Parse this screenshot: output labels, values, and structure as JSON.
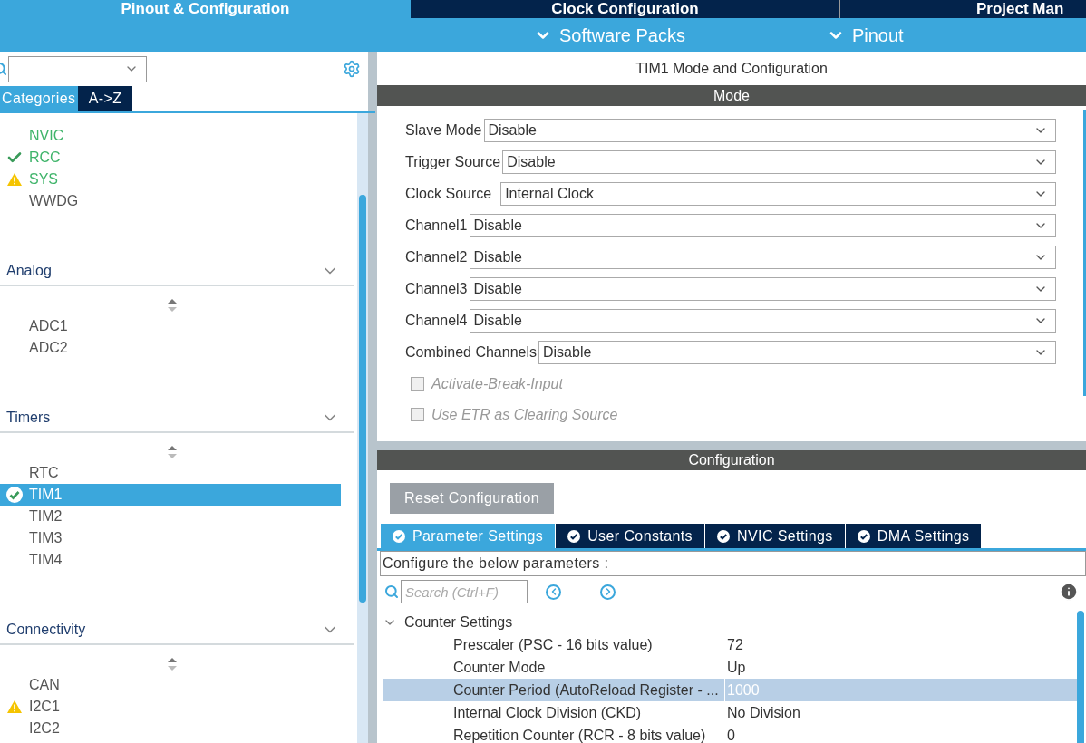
{
  "main_tabs": [
    {
      "label": "Pinout & Configuration",
      "selected": true
    },
    {
      "label": "Clock Configuration",
      "selected": false
    },
    {
      "label": "Project Man",
      "selected": false
    }
  ],
  "sub_menu": [
    "Software Packs",
    "Pinout"
  ],
  "sidebar": {
    "view_tabs": [
      {
        "label": "Categories",
        "selected": true
      },
      {
        "label": "A->Z",
        "selected": false
      }
    ],
    "top_items": [
      {
        "label": "NVIC",
        "kind": "none",
        "enabled": true,
        "selected": false
      },
      {
        "label": "RCC",
        "kind": "check",
        "enabled": true,
        "selected": false
      },
      {
        "label": "SYS",
        "kind": "warning",
        "enabled": true,
        "selected": false
      },
      {
        "label": "WWDG",
        "kind": "none",
        "enabled": false,
        "selected": false
      }
    ],
    "sections": [
      {
        "title": "Analog",
        "expanded": true,
        "items": [
          {
            "label": "ADC1",
            "kind": "none",
            "enabled": false,
            "selected": false
          },
          {
            "label": "ADC2",
            "kind": "none",
            "enabled": false,
            "selected": false
          }
        ]
      },
      {
        "title": "Timers",
        "expanded": true,
        "items": [
          {
            "label": "RTC",
            "kind": "none",
            "enabled": false,
            "selected": false
          },
          {
            "label": "TIM1",
            "kind": "check-circle",
            "enabled": false,
            "selected": true
          },
          {
            "label": "TIM2",
            "kind": "none",
            "enabled": false,
            "selected": false
          },
          {
            "label": "TIM3",
            "kind": "none",
            "enabled": false,
            "selected": false
          },
          {
            "label": "TIM4",
            "kind": "none",
            "enabled": false,
            "selected": false
          }
        ]
      },
      {
        "title": "Connectivity",
        "expanded": true,
        "items": [
          {
            "label": "CAN",
            "kind": "none",
            "enabled": false,
            "selected": false
          },
          {
            "label": "I2C1",
            "kind": "warning",
            "enabled": false,
            "selected": false
          },
          {
            "label": "I2C2",
            "kind": "none",
            "enabled": false,
            "selected": false
          }
        ]
      }
    ]
  },
  "panel_title": "TIM1 Mode and Configuration",
  "mode": {
    "header": "Mode",
    "fields": [
      {
        "label": "Slave Mode",
        "value": "Disable"
      },
      {
        "label": "Trigger Source",
        "value": "Disable"
      },
      {
        "label": "Clock Source",
        "value": "Internal Clock"
      },
      {
        "label": "Channel1",
        "value": "Disable"
      },
      {
        "label": "Channel2",
        "value": "Disable"
      },
      {
        "label": "Channel3",
        "value": "Disable"
      },
      {
        "label": "Channel4",
        "value": "Disable"
      },
      {
        "label": "Combined Channels",
        "value": "Disable"
      }
    ],
    "checkboxes": [
      {
        "label": "Activate-Break-Input",
        "checked": false,
        "disabled": true
      },
      {
        "label": "Use ETR as Clearing Source",
        "checked": false,
        "disabled": true
      }
    ]
  },
  "configuration": {
    "header": "Configuration",
    "reset_button": "Reset Configuration",
    "tabs": [
      {
        "label": "Parameter Settings",
        "selected": true
      },
      {
        "label": "User Constants",
        "selected": false
      },
      {
        "label": "NVIC Settings",
        "selected": false
      },
      {
        "label": "DMA Settings",
        "selected": false
      }
    ],
    "hint": "Configure the below parameters :",
    "search": {
      "placeholder": "Search (Ctrl+F)"
    },
    "group": {
      "title": "Counter Settings",
      "expanded": true,
      "rows": [
        {
          "label": "Prescaler (PSC - 16 bits value)",
          "value": "72",
          "selected": false
        },
        {
          "label": "Counter Mode",
          "value": "Up",
          "selected": false
        },
        {
          "label": "Counter Period (AutoReload Register - ...",
          "value": "1000",
          "selected": true
        },
        {
          "label": "Internal Clock Division (CKD)",
          "value": "No Division",
          "selected": false
        },
        {
          "label": "Repetition Counter (RCR - 8 bits value)",
          "value": "0",
          "selected": false
        }
      ]
    }
  }
}
